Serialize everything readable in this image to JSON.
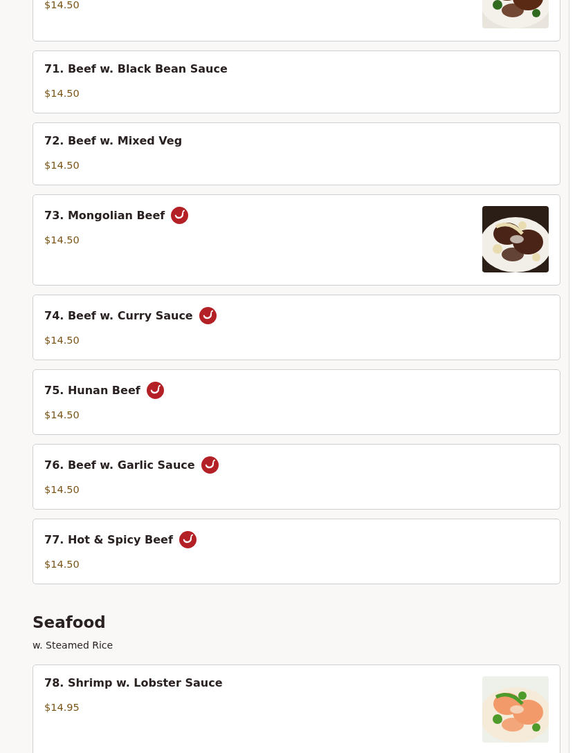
{
  "sections": [
    {
      "items": [
        {
          "price": "$14.50",
          "spicy": false,
          "picture": true
        },
        {
          "name": "71. Beef w. Black Bean Sauce",
          "price": "$14.50",
          "spicy": false
        },
        {
          "name": "72. Beef w. Mixed Veg",
          "price": "$14.50",
          "spicy": false
        },
        {
          "name": "73. Mongolian Beef",
          "price": "$14.50",
          "spicy": true,
          "picture": true
        },
        {
          "name": "74. Beef w. Curry Sauce",
          "price": "$14.50",
          "spicy": true
        },
        {
          "name": "75. Hunan Beef",
          "price": "$14.50",
          "spicy": true
        },
        {
          "name": "76. Beef w. Garlic Sauce",
          "price": "$14.50",
          "spicy": true
        },
        {
          "name": "77. Hot & Spicy Beef",
          "price": "$14.50",
          "spicy": true
        }
      ]
    },
    {
      "title": "Seafood",
      "subtitle": "w. Steamed Rice",
      "items": [
        {
          "name": "78. Shrimp w. Lobster Sauce",
          "price": "$14.95",
          "spicy": false,
          "picture": true
        }
      ]
    }
  ]
}
